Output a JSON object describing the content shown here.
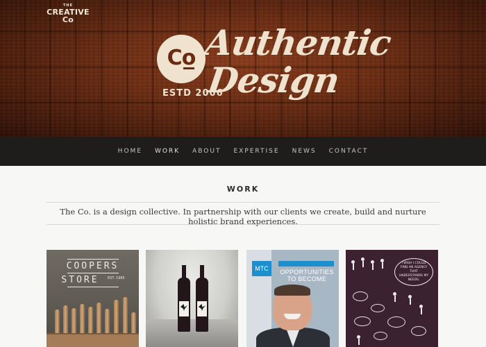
{
  "brand": {
    "small_the": "THE",
    "small_name": "CREATIVE Co",
    "logo_mark": "Co",
    "headline_line1": "Authentic",
    "headline_line2": "Design",
    "established": "ESTD 2006"
  },
  "nav": {
    "items": [
      "HOME",
      "WORK",
      "ABOUT",
      "EXPERTISE",
      "NEWS",
      "CONTACT"
    ]
  },
  "main": {
    "section_title": "WORK",
    "intro": "The Co. is a design collective. In partnership with our clients we create, build and nurture holistic brand experiences."
  },
  "thumbnails": {
    "coopers_line1": "COOPERS",
    "coopers_line2": "STORE",
    "coopers_est": "EST. 1985",
    "mtc_badge": "MTC",
    "mtc_headline": "OPPORTUNITIES TO BECOME",
    "sketch_bubble": "I WISH I COULD FIND AN AGENCY THAT UNDERSTANDS MY NEEDS."
  },
  "colors": {
    "nav_bg": "#1e1d1b",
    "accent_blue": "#1d8fcf",
    "cream": "#efe3cf",
    "wood": "#6c2d14"
  }
}
